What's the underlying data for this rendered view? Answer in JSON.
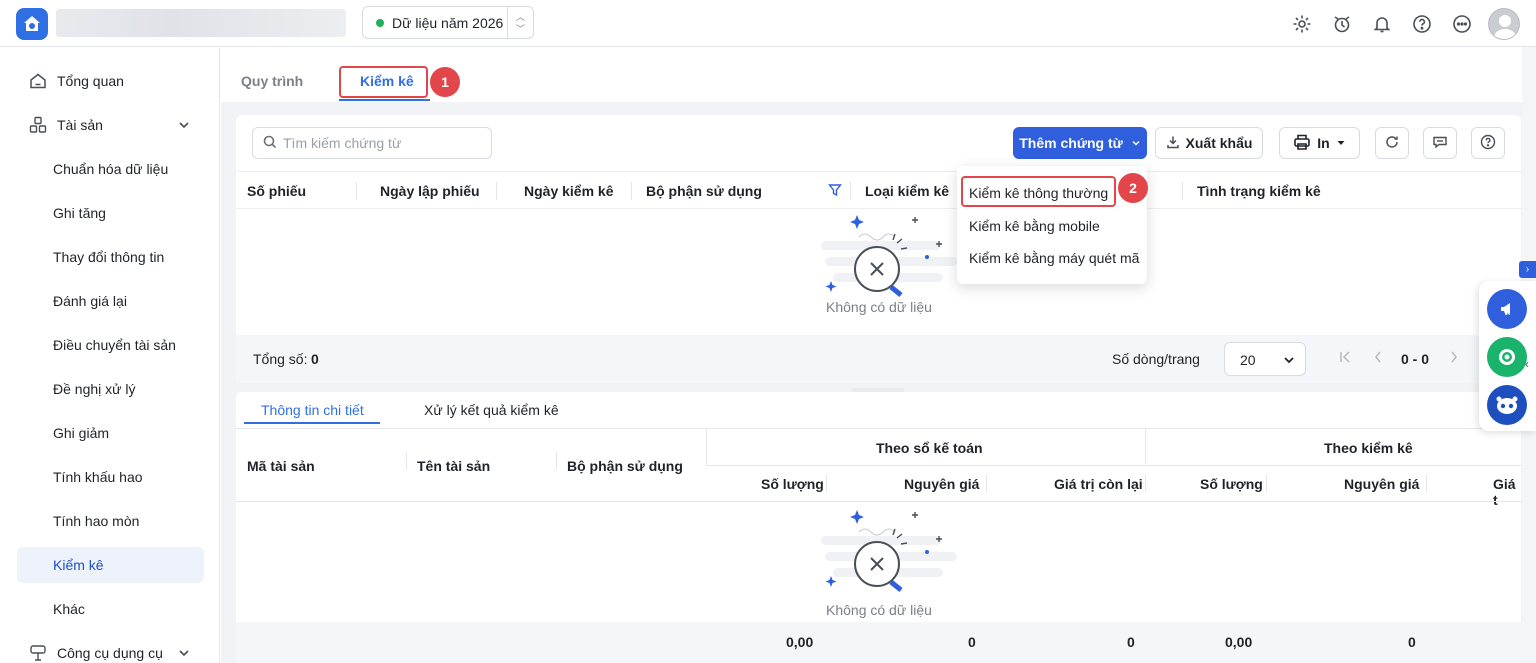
{
  "header": {
    "year_label": "Dữ liệu năm 2026"
  },
  "sidebar": {
    "items": [
      {
        "label": "Tổng quan"
      },
      {
        "label": "Tài sản"
      },
      {
        "label": "Chuẩn hóa dữ liệu"
      },
      {
        "label": "Ghi tăng"
      },
      {
        "label": "Thay đổi thông tin"
      },
      {
        "label": "Đánh giá lại"
      },
      {
        "label": "Điều chuyển tài sản"
      },
      {
        "label": "Đề nghị xử lý"
      },
      {
        "label": "Ghi giảm"
      },
      {
        "label": "Tính khấu hao"
      },
      {
        "label": "Tính hao mòn"
      },
      {
        "label": "Kiểm kê"
      },
      {
        "label": "Khác"
      },
      {
        "label": "Công cụ dụng cụ"
      }
    ]
  },
  "tabs": {
    "process": "Quy trình",
    "inventory": "Kiểm kê"
  },
  "markers": {
    "one": "1",
    "two": "2"
  },
  "toolbar": {
    "search_placeholder": "Tìm kiếm chứng từ",
    "add_label": "Thêm chứng từ",
    "export_label": "Xuất khẩu",
    "print_label": "In"
  },
  "table": {
    "columns": [
      "Số phiếu",
      "Ngày lập phiếu",
      "Ngày kiểm kê",
      "Bộ phận sử dụng",
      "Loại kiểm kê",
      "Tình trạng kiểm kê"
    ],
    "empty_text": "Không có dữ liệu",
    "total_label": "Tổng số:",
    "total_value": "0",
    "rows_per_page_label": "Số dòng/trang",
    "rows_per_page": "20",
    "page_range": "0 - 0"
  },
  "dropdown": {
    "items": [
      "Kiểm kê thông thường",
      "Kiểm kê bằng mobile",
      "Kiểm kê bằng máy quét mã"
    ]
  },
  "detail": {
    "tabs": [
      "Thông tin chi tiết",
      "Xử lý kết quả kiểm kê"
    ],
    "columns": {
      "asset_code": "Mã tài sản",
      "asset_name": "Tên tài sản",
      "department": "Bộ phận sử dụng",
      "group_accounting": "Theo sổ kế toán",
      "group_inventory": "Theo kiểm kê",
      "qty": "Số lượng",
      "cost": "Nguyên giá",
      "remaining": "Giá trị còn lại",
      "qty2": "Số lượng",
      "cost2": "Nguyên giá",
      "remaining2": "Giá t"
    },
    "empty_text": "Không có dữ liệu",
    "totals": [
      "0,00",
      "0",
      "0",
      "0,00",
      "0"
    ]
  }
}
